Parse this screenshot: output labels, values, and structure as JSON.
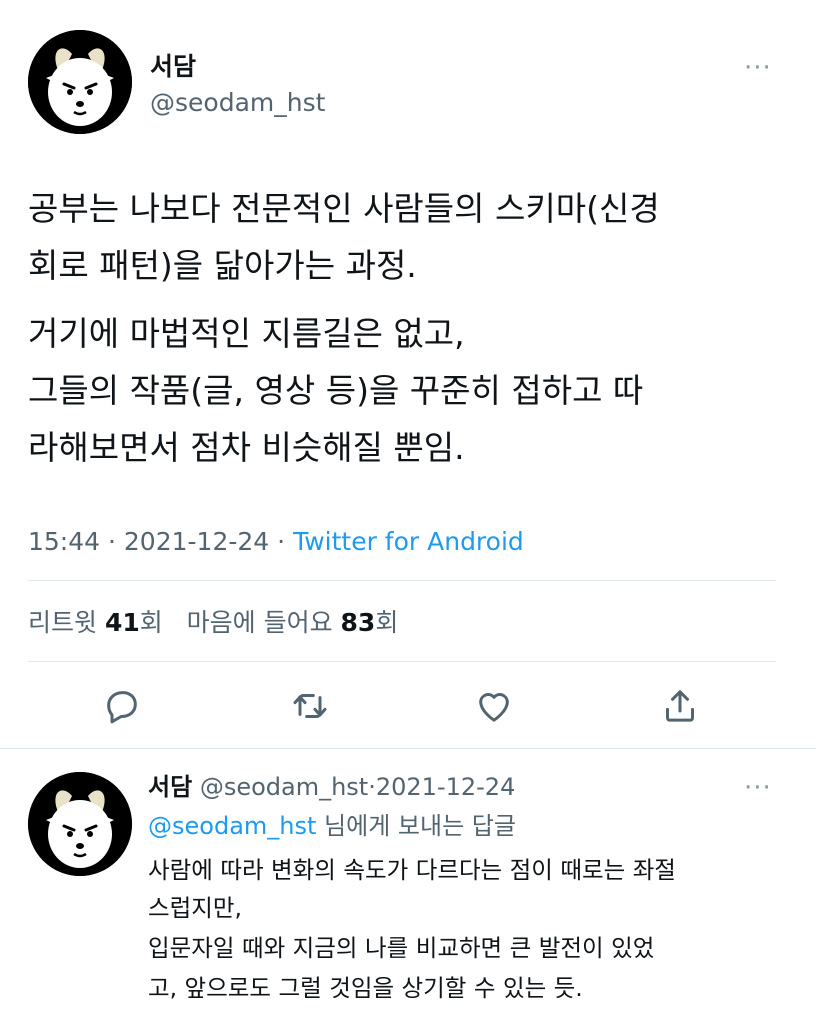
{
  "tweet": {
    "author_name": "서담",
    "author_handle": "@seodam_hst",
    "lines": [
      "공부는 나보다 전문적인 사람들의 스키마(신경",
      "회로 패턴)을 닮아가는 과정.",
      "거기에 마법적인 지름길은 없고,",
      "그들의 작품(글, 영상 등)을 꾸준히 접하고 따",
      "라해보면서 점차 비슷해질 뿐임."
    ],
    "time": "15:44",
    "separator": "·",
    "date": "2021-12-24",
    "source": "Twitter for Android",
    "stats": {
      "retweet_label": "리트윗",
      "retweet_count": "41",
      "retweet_unit": "회",
      "like_label": "마음에 들어요",
      "like_count": "83",
      "like_unit": "회"
    },
    "more": "···"
  },
  "actions": {
    "reply": "reply-icon",
    "retweet": "retweet-icon",
    "like": "heart-icon",
    "share": "share-icon"
  },
  "reply": {
    "author_name": "서담",
    "author_handle": "@seodam_hst",
    "separator": "·",
    "date": "2021-12-24",
    "more": "···",
    "to_mention": "@seodam_hst",
    "to_suffix": " 님에게 보내는 답글",
    "lines": [
      "사람에 따라 변화의 속도가 다르다는 점이 때로는 좌절",
      "스럽지만,",
      "입문자일 때와 지금의 나를 비교하면 큰 발전이 있었",
      "고, 앞으로도 그럴 것임을 상기할 수 있는 듯."
    ]
  },
  "colors": {
    "accent": "#1d9bf0",
    "secondary": "#536471",
    "divider": "#e1e6ea"
  }
}
